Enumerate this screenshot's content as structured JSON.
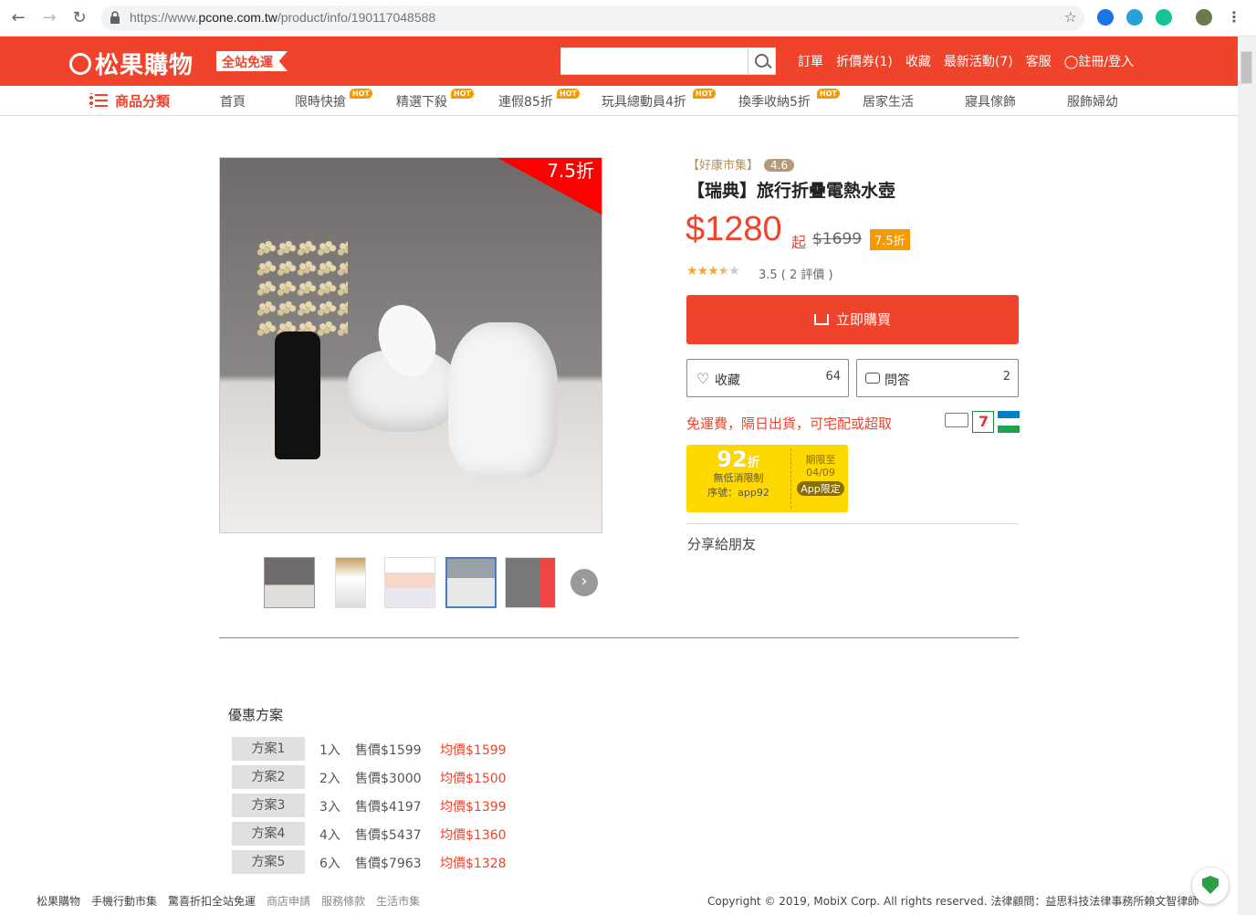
{
  "browser": {
    "url_prefix": "https://www.",
    "url_domain": "pcone.com.tw",
    "url_path": "/product/info/190117048588"
  },
  "header": {
    "logo": "松果購物",
    "free_shipping_tag": "全站免運",
    "search_placeholder": "",
    "links": [
      "訂單",
      "折價券(1)",
      "收藏",
      "最新活動(7)",
      "客服",
      "註冊/登入"
    ]
  },
  "categories": {
    "main": "商品分類",
    "items": [
      {
        "label": "首頁",
        "hot": ""
      },
      {
        "label": "限時快搶",
        "hot": "HOT"
      },
      {
        "label": "精選下殺",
        "hot": "HOT"
      },
      {
        "label": "連假85折",
        "hot": "HOT"
      },
      {
        "label": "玩具總動員4折",
        "hot": "HOT"
      },
      {
        "label": "換季收納5折",
        "hot": "HOT"
      },
      {
        "label": "居家生活",
        "hot": ""
      },
      {
        "label": "寢具傢飾",
        "hot": ""
      },
      {
        "label": "服飾婦幼",
        "hot": ""
      }
    ]
  },
  "product": {
    "image_discount": "7.5折",
    "shop": "【好康市集】",
    "shop_rating": "4.6",
    "title": "【瑞典】旅行折疊電熱水壺",
    "price": "$1280",
    "price_suffix": "起",
    "old_price": "$1699",
    "discount_badge": "7.5折",
    "rating": 3.5,
    "reviews_text": "3.5 ( 2 評價 )",
    "buy_label": "立即購買",
    "fav_label": "收藏",
    "fav_count": "64",
    "qa_label": "問答",
    "qa_count": "2",
    "shipping_text": "免運費，隔日出貨，可宅配或超取",
    "share_label": "分享給朋友"
  },
  "coupon": {
    "pct": "92",
    "pct_unit": "折",
    "line1": "無低消限制",
    "line2": "序號：app92",
    "expire_label": "期限至",
    "expire_date": "04/09",
    "app_only": "App限定"
  },
  "promo": {
    "title": "優惠方案",
    "plans": [
      {
        "tag": "方案1",
        "qty": "1入",
        "sale": "售價$1599",
        "avg": "均價$1599"
      },
      {
        "tag": "方案2",
        "qty": "2入",
        "sale": "售價$3000",
        "avg": "均價$1500"
      },
      {
        "tag": "方案3",
        "qty": "3入",
        "sale": "售價$4197",
        "avg": "均價$1399"
      },
      {
        "tag": "方案4",
        "qty": "4入",
        "sale": "售價$5437",
        "avg": "均價$1360"
      },
      {
        "tag": "方案5",
        "qty": "6入",
        "sale": "售價$7963",
        "avg": "均價$1328"
      }
    ]
  },
  "footer": {
    "brand": "松果購物",
    "links": [
      "手機行動市集",
      "驚喜折扣全站免運",
      "商店申請",
      "服務條款",
      "生活市集"
    ],
    "copyright": "Copyright © 2019, MobiX Corp. All rights reserved. 法律顧問：益思科技法律事務所賴文智律師"
  }
}
